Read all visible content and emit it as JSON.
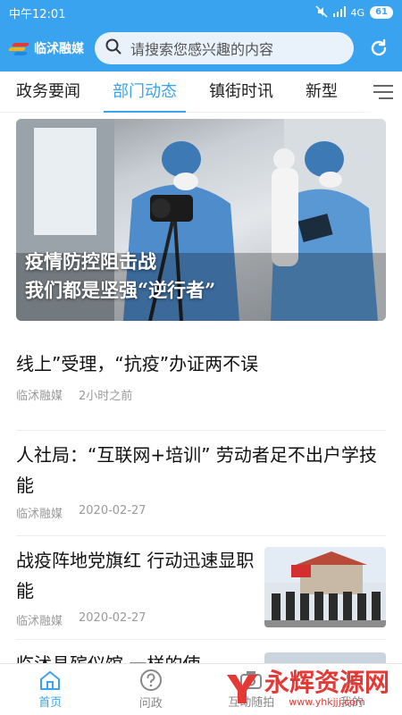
{
  "status_bar": {
    "time": "中午12:01",
    "network": "4G",
    "battery": "61"
  },
  "header": {
    "logo_text": "临沭融媒",
    "search_placeholder": "请搜索您感兴趣的内容"
  },
  "tabs": [
    {
      "label": "政务要闻",
      "active": false
    },
    {
      "label": "部门动态",
      "active": true
    },
    {
      "label": "镇街时讯",
      "active": false
    },
    {
      "label": "新型",
      "active": false
    }
  ],
  "hero": {
    "caption_line1": "疫情防控阻击战",
    "caption_line2": "我们都是坚强“逆行者”"
  },
  "news": [
    {
      "title": "线上”受理，“抗疫”办证两不误",
      "source": "临沭融媒",
      "time": "2小时之前"
    },
    {
      "title": "人社局：“互联网+培训” 劳动者足不出户学技能",
      "source": "临沭融媒",
      "time": "2020-02-27"
    },
    {
      "title": "战疫阵地党旗红 行动迅速显职能",
      "source": "临沭融媒",
      "time": "2020-02-27"
    },
    {
      "title": "临沭县殡仪馆 一样的使",
      "source": "",
      "time": ""
    }
  ],
  "bottom_nav": [
    {
      "label": "首页",
      "icon": "home-icon",
      "active": true
    },
    {
      "label": "问政",
      "icon": "question-icon",
      "active": false
    },
    {
      "label": "互动随拍",
      "icon": "camera-icon",
      "active": false
    },
    {
      "label": "我的",
      "icon": "user-icon",
      "active": false
    }
  ],
  "watermark": {
    "text": "永辉资源网",
    "url": "www.yhkjjj.com"
  },
  "colors": {
    "accent": "#3aa3f0",
    "text": "#222222",
    "meta": "#999999",
    "watermark": "#e53935"
  }
}
